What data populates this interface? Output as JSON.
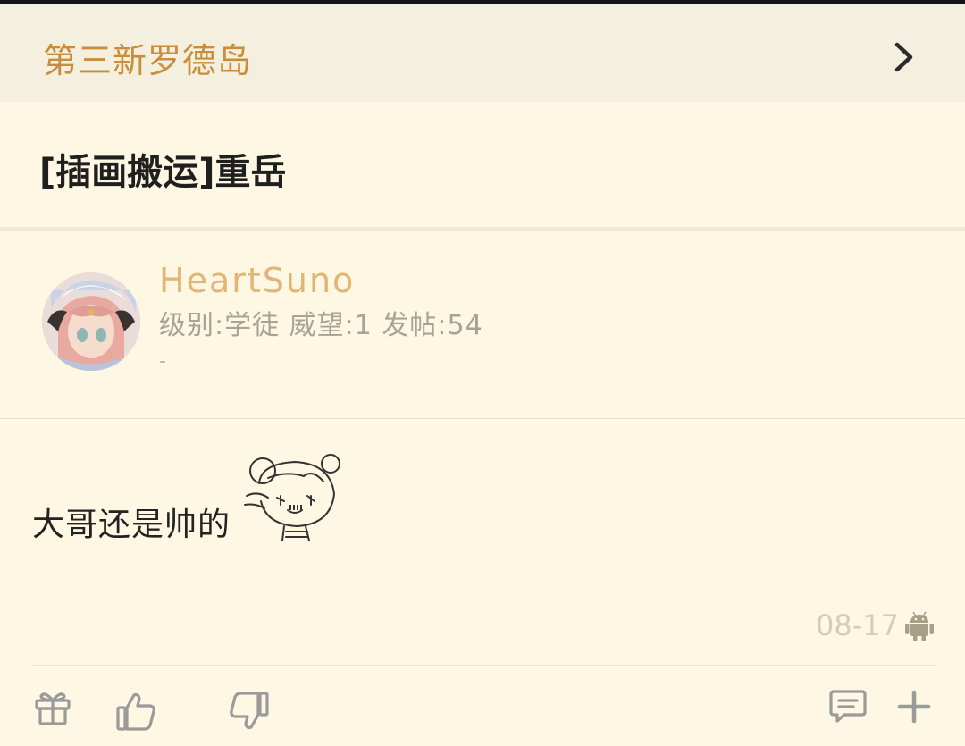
{
  "forum": {
    "name": "第三新罗德岛"
  },
  "thread": {
    "title": "[插画搬运]重岳"
  },
  "author": {
    "username": "HeartSuno",
    "stats": "级别:学徒 威望:1 发帖:54",
    "signature": "-"
  },
  "post": {
    "content": "大哥还是帅的",
    "date": "08-17",
    "client_icon": "android-icon"
  },
  "actions": {
    "icons": [
      "gift-icon",
      "thumbs-up-icon",
      "thumbs-down-icon",
      "reply-icon",
      "plus-icon"
    ]
  },
  "colors": {
    "background": "#fdf7e3",
    "forum_bar": "#f4efdf",
    "forum_name": "#c98e3a",
    "username": "#e3b574",
    "muted": "#a9a395",
    "icon": "#9a9a9a"
  }
}
